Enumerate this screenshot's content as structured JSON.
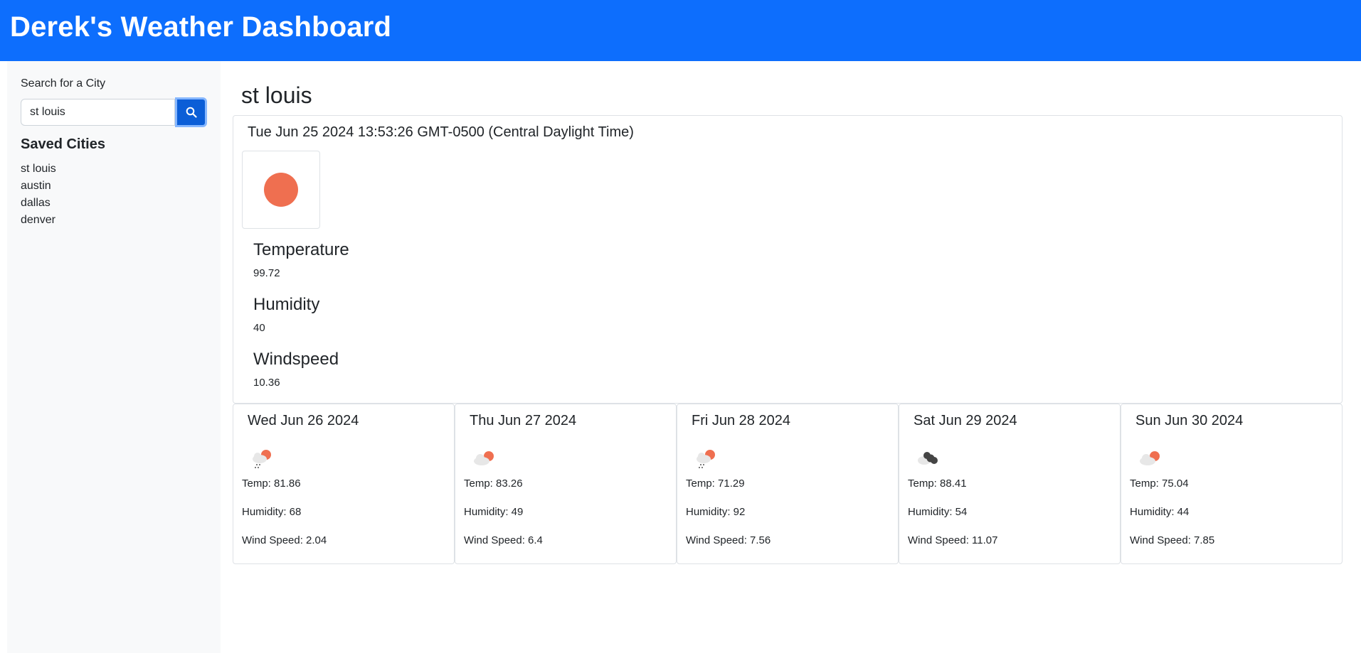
{
  "header": {
    "title": "Derek's Weather Dashboard"
  },
  "sidebar": {
    "search_label": "Search for a City",
    "search_value": "st louis",
    "saved_title": "Saved Cities",
    "saved_cities": [
      "st louis",
      "austin",
      "dallas",
      "denver"
    ]
  },
  "current": {
    "city": "st louis",
    "datetime": "Tue Jun 25 2024 13:53:26 GMT-0500 (Central Daylight Time)",
    "icon": "sun-icon",
    "temperature_label": "Temperature",
    "temperature": "99.72",
    "humidity_label": "Humidity",
    "humidity": "40",
    "windspeed_label": "Windspeed",
    "windspeed": "10.36"
  },
  "forecast": [
    {
      "date": "Wed Jun 26 2024",
      "icon": "sun-cloud-rain-icon",
      "temp": "Temp: 81.86",
      "humidity": "Humidity: 68",
      "wind": "Wind Speed: 2.04"
    },
    {
      "date": "Thu Jun 27 2024",
      "icon": "sun-cloud-icon",
      "temp": "Temp: 83.26",
      "humidity": "Humidity: 49",
      "wind": "Wind Speed: 6.4"
    },
    {
      "date": "Fri Jun 28 2024",
      "icon": "sun-cloud-rain-icon",
      "temp": "Temp: 71.29",
      "humidity": "Humidity: 92",
      "wind": "Wind Speed: 7.56"
    },
    {
      "date": "Sat Jun 29 2024",
      "icon": "dark-clouds-icon",
      "temp": "Temp: 88.41",
      "humidity": "Humidity: 54",
      "wind": "Wind Speed: 11.07"
    },
    {
      "date": "Sun Jun 30 2024",
      "icon": "sun-cloud-icon",
      "temp": "Temp: 75.04",
      "humidity": "Humidity: 44",
      "wind": "Wind Speed: 7.85"
    }
  ],
  "colors": {
    "header": "#0d6efd",
    "sun": "#ef6f50",
    "sidebar": "#f8f9fa",
    "button": "#0b5ed7"
  }
}
